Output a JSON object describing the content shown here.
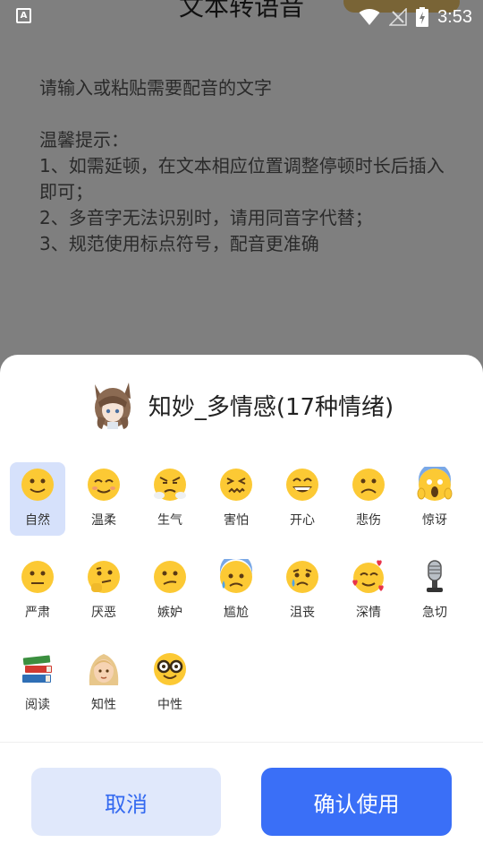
{
  "status_bar": {
    "time": "3:53",
    "left_icon": "A"
  },
  "app": {
    "title": "文本转语音",
    "editor_lines": "请输入或粘贴需要配音的文字\n\n温馨提示：\n1、如需延顿，在文本相应位置调整停顿时长后插入即可；\n2、多音字无法识别时，请用同音字代替；\n3、规范使用标点符号，配音更准确"
  },
  "sheet": {
    "voice_name": "知妙_多情感(17种情绪)",
    "emotions": [
      {
        "label": "自然",
        "icon": "slightly-smiling-face-icon",
        "selected": true
      },
      {
        "label": "温柔",
        "icon": "smiling-face-icon"
      },
      {
        "label": "生气",
        "icon": "steam-from-nose-face-icon"
      },
      {
        "label": "害怕",
        "icon": "confounded-face-icon"
      },
      {
        "label": "开心",
        "icon": "grinning-face-icon"
      },
      {
        "label": "悲伤",
        "icon": "frowning-face-icon"
      },
      {
        "label": "惊讶",
        "icon": "screaming-face-icon"
      },
      {
        "label": "严肃",
        "icon": "neutral-face-icon"
      },
      {
        "label": "厌恶",
        "icon": "thinking-face-icon"
      },
      {
        "label": "嫉妒",
        "icon": "confused-face-icon"
      },
      {
        "label": "尴尬",
        "icon": "anxious-sweat-face-icon"
      },
      {
        "label": "沮丧",
        "icon": "crying-face-icon"
      },
      {
        "label": "深情",
        "icon": "smiling-hearts-face-icon"
      },
      {
        "label": "急切",
        "icon": "microphone-icon"
      },
      {
        "label": "阅读",
        "icon": "books-icon"
      },
      {
        "label": "知性",
        "icon": "woman-icon"
      },
      {
        "label": "中性",
        "icon": "nerd-face-icon"
      }
    ],
    "cancel_label": "取消",
    "confirm_label": "确认使用"
  },
  "colors": {
    "selected_bg": "#d6e1fb",
    "confirm_bg": "#3a6ff7",
    "cancel_bg": "#e0e8fb",
    "cancel_text": "#3369f0"
  }
}
